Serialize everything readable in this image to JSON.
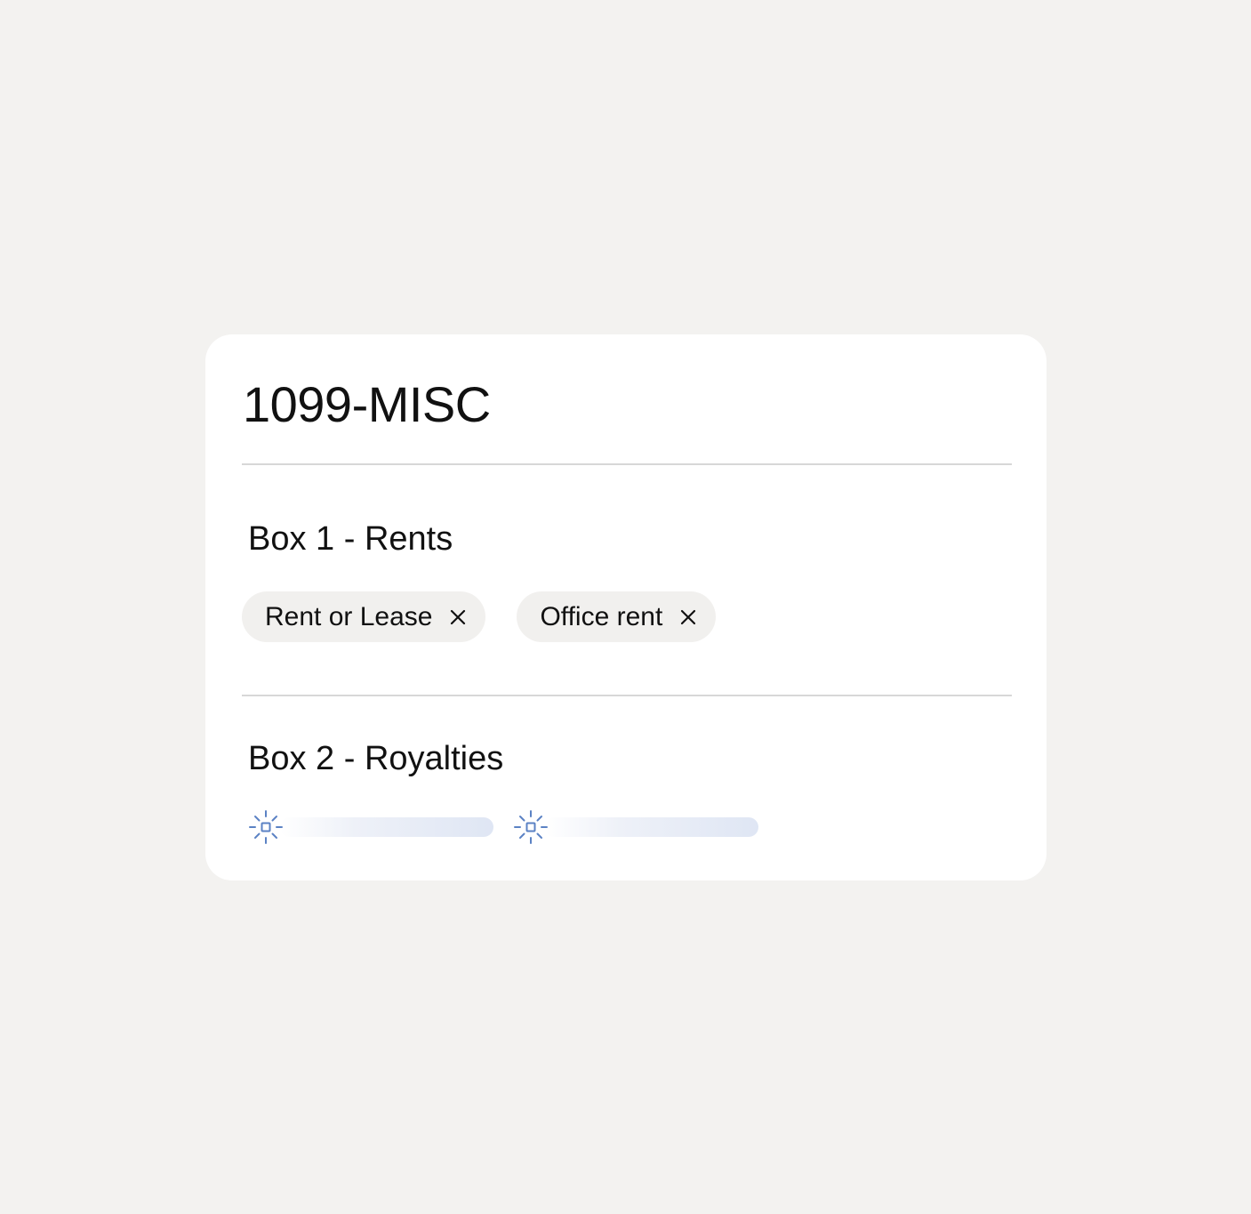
{
  "form": {
    "title": "1099-MISC"
  },
  "sections": [
    {
      "title": "Box 1 - Rents",
      "chips": [
        {
          "label": "Rent or Lease",
          "remove_icon": "close-icon"
        },
        {
          "label": "Office rent",
          "remove_icon": "close-icon"
        }
      ]
    },
    {
      "title": "Box 2 - Royalties",
      "loading_placeholders": [
        {
          "icon": "ai-sparkle-icon"
        },
        {
          "icon": "ai-sparkle-icon"
        }
      ]
    }
  ],
  "colors": {
    "page_background": "#f3f2f0",
    "card_background": "#ffffff",
    "chip_background": "#f1f0ee",
    "divider": "#d7d7d7",
    "accent_icon": "#5b82c4",
    "skeleton": "#dfe6f4"
  }
}
